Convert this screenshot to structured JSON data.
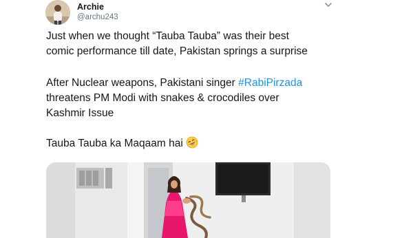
{
  "tweet": {
    "author": {
      "name": "Archie",
      "handle": "@archu243"
    },
    "paragraph1": [
      "Just when we thought “Tauba Tauba” was their best",
      "comic performance till date, Pakistan springs a surprise"
    ],
    "paragraph2": {
      "line1_prefix": "After Nuclear weapons, Pakistani singer ",
      "hashtag": "#RabiPirzada",
      "line2": "threatens PM Modi with snakes & crocodiles over",
      "line3": "Kashmir Issue"
    },
    "paragraph3": "Tauba Tauba ka Maqaam hai",
    "emoji": "rolling-on-floor-laughing-emoji",
    "colors": {
      "hashtag": "#1b95e0",
      "handle": "#657786",
      "text": "#14171a",
      "dress": "#e8176d"
    }
  }
}
